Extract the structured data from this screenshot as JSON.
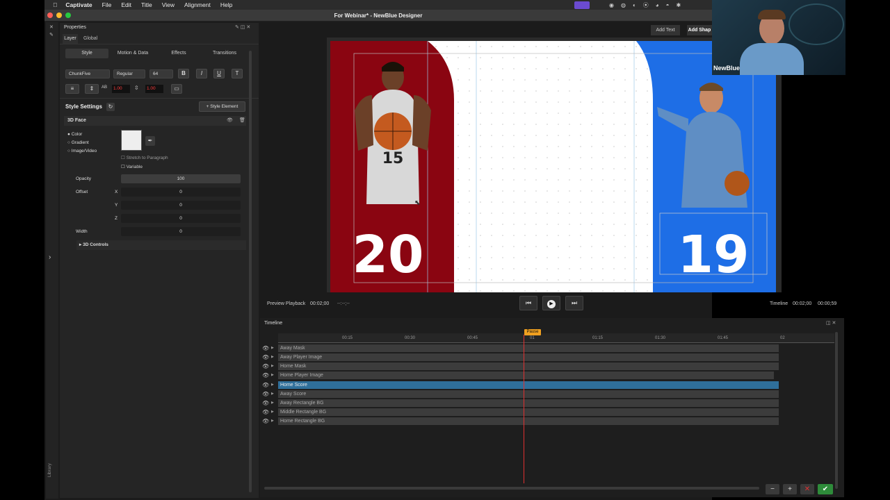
{
  "menu": {
    "app": "Captivate",
    "items": [
      "File",
      "Edit",
      "Title",
      "View",
      "Alignment",
      "Help"
    ]
  },
  "window": {
    "title": "For Webinar* - NewBlue Designer"
  },
  "properties": {
    "title": "Properties",
    "tabs": [
      "Layer",
      "Global"
    ],
    "subtabs": [
      "Style",
      "Motion & Data",
      "Effects",
      "Transitions"
    ],
    "font": "ChunkFive",
    "weight": "Regular",
    "size": "64",
    "bold": "B",
    "italic": "I",
    "underline": "U",
    "tt": "T",
    "spacing_a": "1.00",
    "spacing_b": "1.00"
  },
  "style_settings": {
    "title": "Style Settings",
    "add": "+ Style Element",
    "section": "3D Face",
    "fill_options": [
      "Color",
      "Gradient",
      "Image/Video"
    ],
    "stretch": "Stretch to Paragraph",
    "variable": "Variable",
    "opacity_label": "Opacity",
    "opacity": "100",
    "offset_label": "Offset",
    "x_label": "X",
    "x": "0",
    "y_label": "Y",
    "y": "0",
    "z_label": "Z",
    "z": "0",
    "width_label": "Width",
    "width": "0",
    "controls": "3D Controls"
  },
  "toolbar": {
    "add_text": "Add Text",
    "add_shape": "Add Shap"
  },
  "canvas": {
    "score_home": "20",
    "score_away": "19",
    "jersey": "15",
    "colors": {
      "home": "#8a0511",
      "away": "#1e6ee6",
      "middle": "#ffffff"
    }
  },
  "playback": {
    "preview_label": "Preview Playback",
    "preview_time": "00:02;00",
    "dash": "--:--;--",
    "timeline_label": "Timeline",
    "tl_time": "00:02;00",
    "tl_dur": "00:00;59"
  },
  "timeline": {
    "title": "Timeline",
    "playhead": "Pause",
    "ticks": [
      "00:15",
      "00:30",
      "00:45",
      "01",
      "01:15",
      "01:30",
      "01:45",
      "02"
    ],
    "layers": [
      "Away Mask",
      "Away Player Image",
      "Home Mask",
      "Home Player Image",
      "Home Score",
      "Away Score",
      "Away Rectangle BG",
      "Middle Rectangle BG",
      "Home Rectangle BG"
    ],
    "selected": "Home Score"
  },
  "webcam": {
    "label": "NewBlue"
  },
  "library": "Library"
}
